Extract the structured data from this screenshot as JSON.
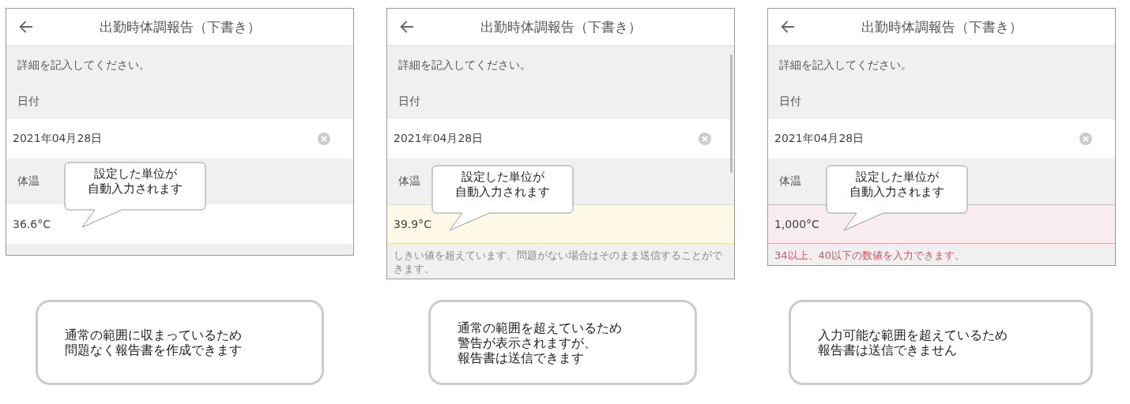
{
  "panels": [
    {
      "title": "出勤時体調報告（下書き）",
      "instruction": "詳細を記入してください。",
      "date_label": "日付",
      "date_value": "2021年04月28日",
      "temp_label": "体温",
      "temp_value": "36.6°C",
      "warning": false,
      "error": false,
      "scrollbar": false,
      "callout": [
        "設定した単位が",
        "自動入力されます"
      ],
      "caption": [
        "通常の範囲に収まっているため",
        "問題なく報告書を作成できます"
      ]
    },
    {
      "title": "出勤時体調報告（下書き）",
      "instruction": "詳細を記入してください。",
      "date_label": "日付",
      "date_value": "2021年04月28日",
      "temp_label": "体温",
      "temp_value": "39.9°C",
      "warning": true,
      "error": false,
      "scrollbar": true,
      "message": "しきい値を超えています。問題がない場合はそのまま送信することができます。",
      "callout": [
        "設定した単位が",
        "自動入力されます"
      ],
      "caption": [
        "通常の範囲を超えているため",
        "警告が表示されますが、",
        "報告書は送信できます"
      ]
    },
    {
      "title": "出勤時体調報告（下書き）",
      "instruction": "詳細を記入してください。",
      "date_label": "日付",
      "date_value": "2021年04月28日",
      "temp_label": "体温",
      "temp_value": "1,000°C",
      "warning": false,
      "error": true,
      "scrollbar": false,
      "message": "34以上、40以下の数値を入力できます。",
      "callout": [
        "設定した単位が",
        "自動入力されます"
      ],
      "caption": [
        "入力可能な範囲を超えているため",
        "報告書は送信できません"
      ]
    }
  ]
}
